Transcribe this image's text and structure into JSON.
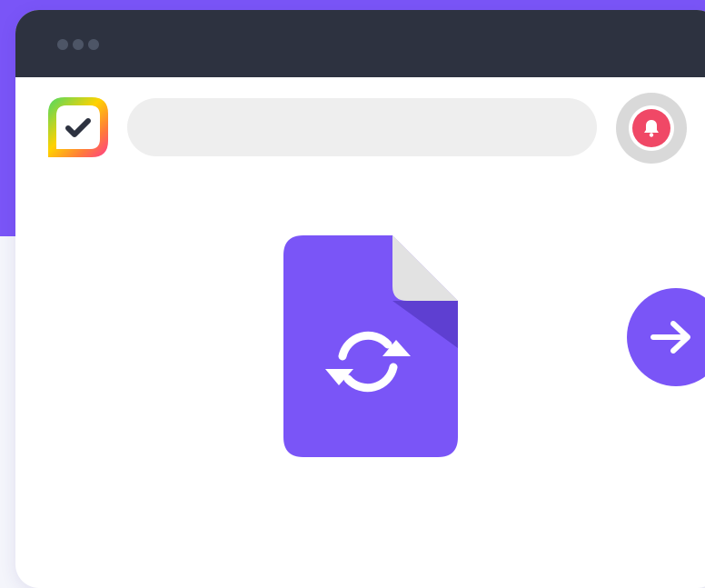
{
  "colors": {
    "accent": "#7a55f7",
    "titlebar": "#2d3240",
    "notification": "#f04866",
    "search_bg": "#eeeeee"
  },
  "titlebar": {
    "dots": [
      "window-dot",
      "window-dot",
      "window-dot"
    ]
  },
  "header": {
    "logo_icon": "checkmark-chat-logo-icon",
    "search": {
      "value": "",
      "placeholder": ""
    },
    "notification_icon": "bell-icon"
  },
  "main": {
    "document_icon": "file-sync-icon",
    "next_icon": "arrow-right-icon"
  }
}
